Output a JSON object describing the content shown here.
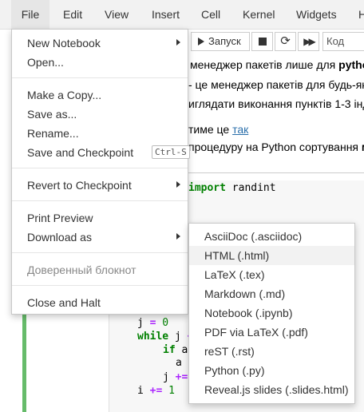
{
  "menubar": {
    "file": "File",
    "edit": "Edit",
    "view": "View",
    "insert": "Insert",
    "cell": "Cell",
    "kernel": "Kernel",
    "widgets": "Widgets",
    "help": "H"
  },
  "toolbar": {
    "run_label": "Запуск",
    "cell_type": "Код"
  },
  "notebook": {
    "line1_pre": "менеджер пакетів лише для ",
    "line1_bold": "python",
    "line2": "- це менеджер пакетів для будь-як",
    "line3": "иглядати виконання пунктів 1-3 інд",
    "line4_pre": "тиме це ",
    "line4_link": "так",
    "line5_pre": "процедуру на Python сортування ",
    "line5_bold": "м"
  },
  "code": {
    "import_kw": "import",
    "import_rest": " randint",
    "l1_var": "j ",
    "l1_op": "=",
    "l1_num": " 0",
    "l2_kw": "while",
    "l2_rest": " j ",
    "l2_tail": "<",
    "l3_kw": "if",
    "l3_rest": " a",
    "l4_pad": "a",
    "l5_var": "j ",
    "l5_op": "+=",
    "l6_var": "i ",
    "l6_op": "+=",
    "l6_num": " 1"
  },
  "file_menu": {
    "new_notebook": "New Notebook",
    "open": "Open...",
    "make_copy": "Make a Copy...",
    "save_as": "Save as...",
    "rename": "Rename...",
    "save_checkpoint": "Save and Checkpoint",
    "save_checkpoint_shortcut": "Ctrl-S",
    "revert": "Revert to Checkpoint",
    "print_preview": "Print Preview",
    "download_as": "Download as",
    "trusted": "Доверенный блокнот",
    "close_halt": "Close and Halt"
  },
  "download_menu": {
    "items": [
      "AsciiDoc (.asciidoc)",
      "HTML (.html)",
      "LaTeX (.tex)",
      "Markdown (.md)",
      "Notebook (.ipynb)",
      "PDF via LaTeX (.pdf)",
      "reST (.rst)",
      "Python (.py)",
      "Reveal.js slides (.slides.html)"
    ],
    "highlighted": "HTML (.html)"
  }
}
